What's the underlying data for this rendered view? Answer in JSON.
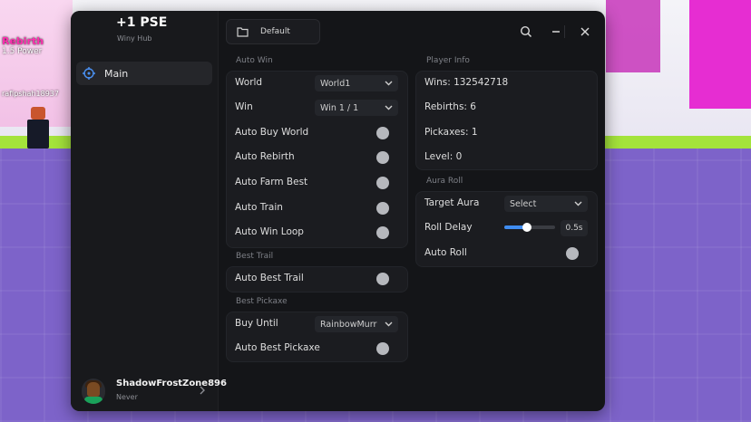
{
  "game": {
    "rebirth_label": "Rebirth",
    "power_label": "1.5 Power",
    "player_tag": "rafipshah18937"
  },
  "window": {
    "title": "+1 PSE",
    "subtitle": "Winy Hub",
    "tab": "Default"
  },
  "sidebar": {
    "items": [
      {
        "label": "Main",
        "icon": "crosshair-icon"
      }
    ]
  },
  "user": {
    "name": "ShadowFrostZone896",
    "status": "Never"
  },
  "auto_win": {
    "title": "Auto Win",
    "world_label": "World",
    "world_value": "World1",
    "win_label": "Win",
    "win_value": "Win 1 / 1",
    "toggles": [
      "Auto Buy World",
      "Auto Rebirth",
      "Auto Farm Best",
      "Auto Train",
      "Auto Win Loop"
    ]
  },
  "best_trail": {
    "title": "Best Trail",
    "toggle": "Auto Best Trail"
  },
  "best_pickaxe": {
    "title": "Best Pickaxe",
    "buy_label": "Buy Until",
    "buy_value": "RainbowMurr",
    "toggle": "Auto Best Pickaxe"
  },
  "player_info": {
    "title": "Player Info",
    "wins": "Wins: 132542718",
    "rebirths": "Rebirths: 6",
    "pickaxes": "Pickaxes: 1",
    "level": "Level: 0"
  },
  "aura_roll": {
    "title": "Aura Roll",
    "target_label": "Target Aura",
    "target_value": "Select",
    "delay_label": "Roll Delay",
    "delay_value": "0.5s",
    "delay_fraction": 0.45,
    "auto_roll": "Auto Roll"
  },
  "colors": {
    "window_bg": "#141518",
    "card_bg": "#1b1c20",
    "accent": "#3f8cf0",
    "toggle_off": "#b6b8bd"
  }
}
